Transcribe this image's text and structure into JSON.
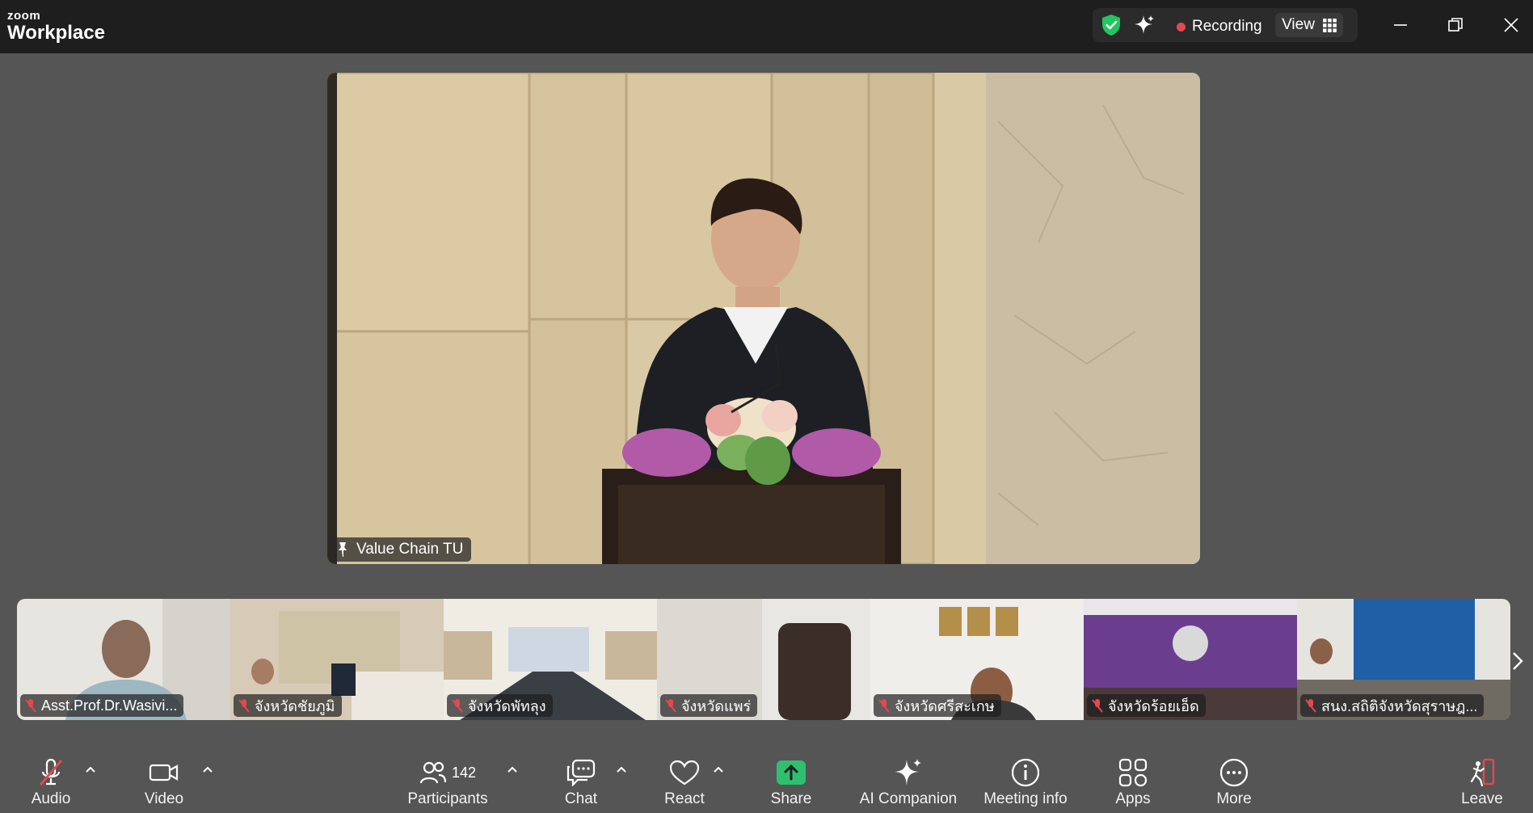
{
  "app": {
    "brand_small": "zoom",
    "brand_large": "Workplace"
  },
  "titlebar": {
    "recording_label": "Recording",
    "view_label": "View",
    "icons": [
      "shield-check-icon",
      "ai-sparkle-icon",
      "grid-icon",
      "minimize-icon",
      "restore-icon",
      "close-icon"
    ]
  },
  "main_video": {
    "participant_name": "Value Chain TU"
  },
  "thumbnails": [
    {
      "name": "Asst.Prof.Dr.Wasivi...",
      "muted": true
    },
    {
      "name": "จังหวัดชัยภูมิ",
      "muted": true
    },
    {
      "name": "จังหวัดพัทลุง",
      "muted": true
    },
    {
      "name": "จังหวัดแพร่",
      "muted": true
    },
    {
      "name": "จังหวัดศรีสะเกษ",
      "muted": true
    },
    {
      "name": "จังหวัดร้อยเอ็ด",
      "muted": true
    },
    {
      "name": "สนง.สถิติจังหวัดสุราษฎ...",
      "muted": true
    }
  ],
  "toolbar": {
    "audio": "Audio",
    "video": "Video",
    "participants": "Participants",
    "participants_count": "142",
    "chat": "Chat",
    "react": "React",
    "share": "Share",
    "ai_companion": "AI Companion",
    "meeting_info": "Meeting info",
    "apps": "Apps",
    "more": "More",
    "leave": "Leave"
  },
  "colors": {
    "titlebar_bg": "#1e1e1e",
    "canvas_bg": "#555555",
    "recording_dot": "#e5484d",
    "share_green": "#2fbf71",
    "shield_green": "#22c55e",
    "leave_red": "#e5484d"
  }
}
